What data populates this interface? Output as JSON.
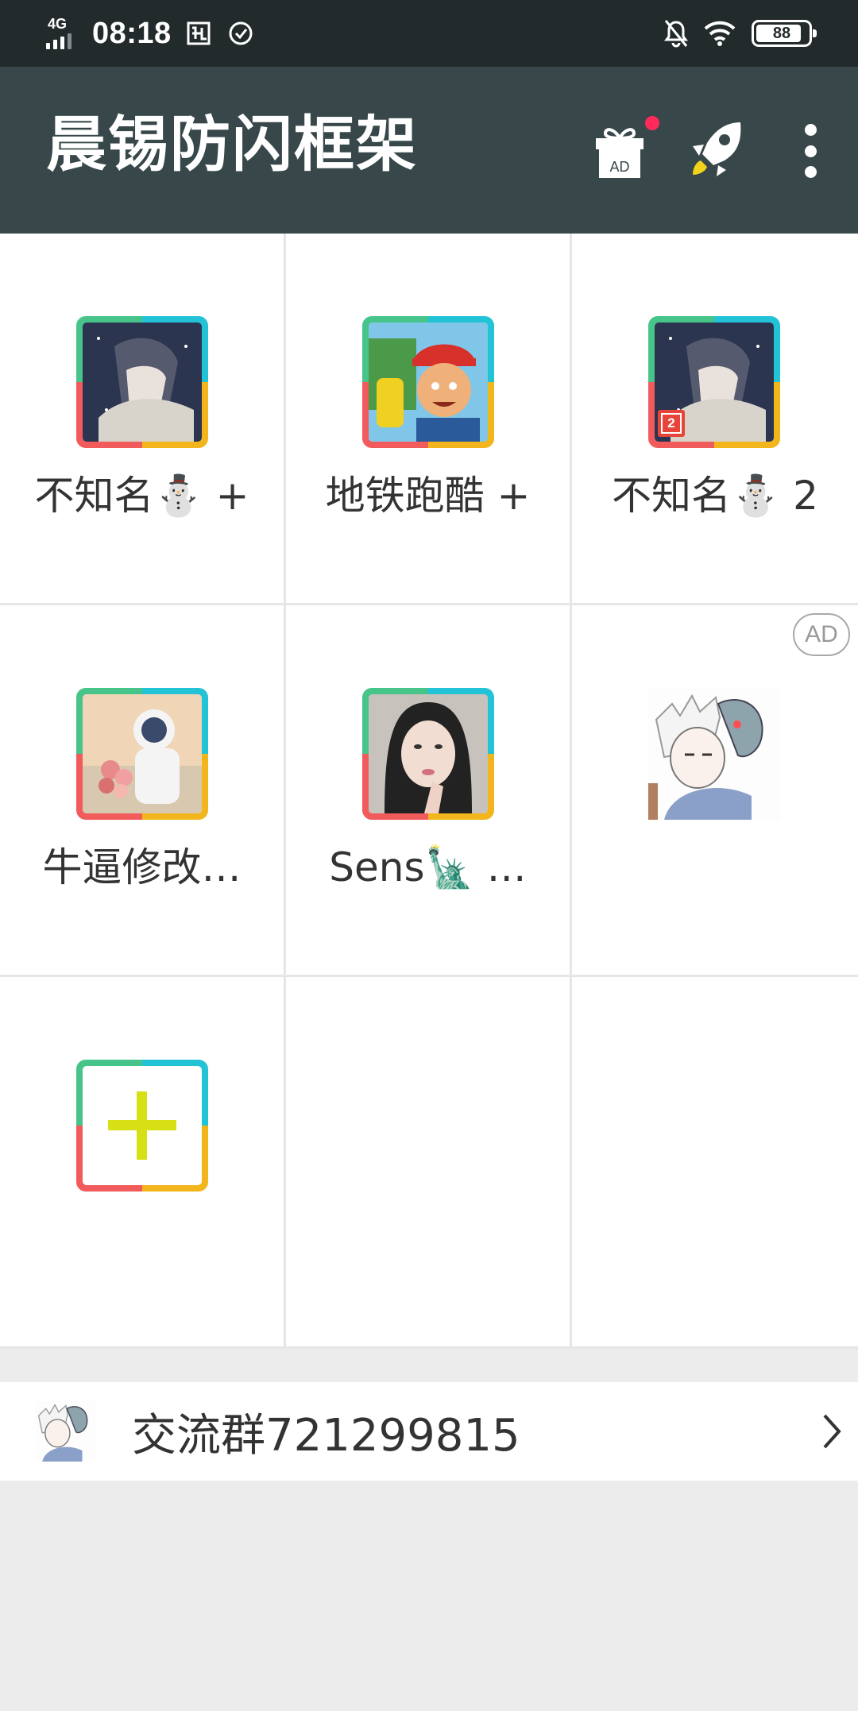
{
  "status_bar": {
    "network": "4G",
    "time": "08:18",
    "battery": "88",
    "battery_level": 0.88,
    "icons": [
      "signal-icon",
      "screenshot-icon",
      "sync-icon",
      "bell-off-icon",
      "wifi-icon",
      "battery-icon"
    ]
  },
  "app_bar": {
    "title": "晨锡防闪框架",
    "gift_icon_text": "AD",
    "actions": [
      "gift-ad-icon",
      "rocket-icon",
      "more-vert-icon"
    ],
    "notification_dot_color": "#ff2a5a"
  },
  "grid": {
    "apps": [
      {
        "label": "不知名⛄ +",
        "icon": "anime-boy-avatar"
      },
      {
        "label": "地铁跑酷 +",
        "icon": "subway-surfers-icon"
      },
      {
        "label": "不知名⛄ 2",
        "icon": "anime-boy-avatar",
        "badge": "2"
      },
      {
        "label": "牛逼修改…",
        "icon": "astronaut-flowers-avatar"
      },
      {
        "label": "Sens🗽 …",
        "icon": "girl-portrait-avatar"
      }
    ],
    "ad_tag": "AD",
    "ad_icon": "anime-mask-avatar",
    "add_icon": "plus-icon"
  },
  "group": {
    "text": "交流群721299815",
    "avatar": "anime-mask-avatar"
  },
  "colors": {
    "status_bar": "#232a2c",
    "app_bar": "#37474a",
    "frame_top_right": "#22c3d6",
    "frame_bottom_right": "#f2b51b",
    "frame_bottom_left": "#f25b5b",
    "frame_top_left": "#46c48a",
    "plus": "#d6e014"
  }
}
